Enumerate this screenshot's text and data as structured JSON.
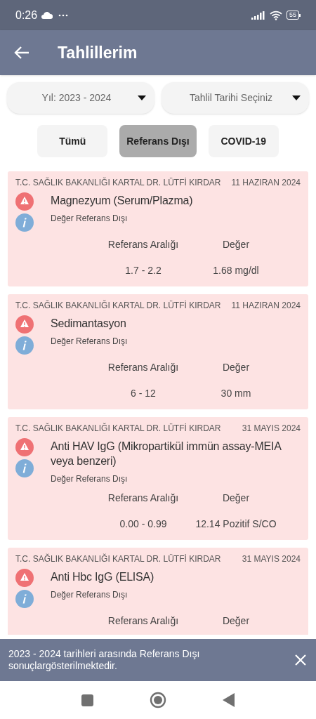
{
  "status_bar": {
    "time": "0:26",
    "battery": "55"
  },
  "app_bar": {
    "title": "Tahlillerim"
  },
  "filters": [
    {
      "value": "Yıl: 2023 - 2024"
    },
    {
      "value": "Tahlil Tarihi Seçiniz"
    }
  ],
  "tabs": [
    {
      "label": "Tümü",
      "selected": false
    },
    {
      "label": "Referans Dışı",
      "selected": true
    },
    {
      "label": "COVID-19",
      "selected": false
    }
  ],
  "results": [
    {
      "hospital": "T.C. SAĞLIK BAKANLIĞI KARTAL DR. LÜTFİ KIRDAR",
      "date": "11 HAZIRAN 2024",
      "test": "Magnezyum (Serum/Plazma)",
      "status": "Değer Referans Dışı",
      "range_label": "Referans Aralığı",
      "value_label": "Değer",
      "range": "1.7 - 2.2",
      "value": "1.68 mg/dl"
    },
    {
      "hospital": "T.C. SAĞLIK BAKANLIĞI KARTAL DR. LÜTFİ KIRDAR",
      "date": "11 HAZIRAN 2024",
      "test": "Sedimantasyon",
      "status": "Değer Referans Dışı",
      "range_label": "Referans Aralığı",
      "value_label": "Değer",
      "range": "6 - 12",
      "value": "30 mm"
    },
    {
      "hospital": "T.C. SAĞLIK BAKANLIĞI KARTAL DR. LÜTFİ KIRDAR",
      "date": "31 MAYIS 2024",
      "test": "Anti HAV IgG (Mikropartikül immün assay-MEIA veya benzeri)",
      "status": "Değer Referans Dışı",
      "range_label": "Referans Aralığı",
      "value_label": "Değer",
      "range": "0.00 - 0.99",
      "value": "12.14 Pozitif S/CO"
    },
    {
      "hospital": "T.C. SAĞLIK BAKANLIĞI KARTAL DR. LÜTFİ KIRDAR",
      "date": "31 MAYIS 2024",
      "test": "Anti Hbc IgG (ELISA)",
      "status": "Değer Referans Dışı",
      "range_label": "Referans Aralığı",
      "value_label": "Değer"
    }
  ],
  "snackbar": {
    "message": "2023 - 2024 tarihleri arasında Referans Dışı sonuçlargösterilmektedir."
  }
}
